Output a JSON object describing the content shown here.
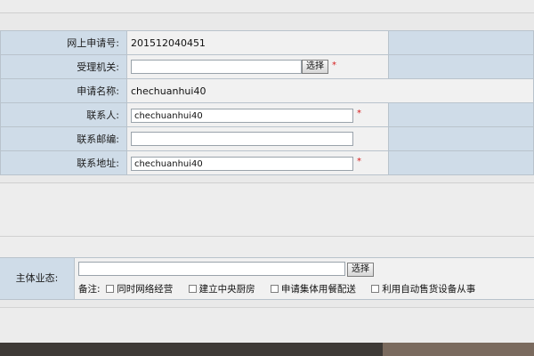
{
  "form": {
    "online_app_no_label": "网上申请号:",
    "online_app_no_value": "201512040451",
    "accept_org_label": "受理机关:",
    "accept_org_value": "",
    "select_label": "选择",
    "applicant_name_label": "申请名称:",
    "applicant_name_value": "chechuanhui40",
    "contact_label": "联系人:",
    "contact_value": "chechuanhui40",
    "postcode_label": "联系邮编:",
    "postcode_value": "",
    "address_label": "联系地址:",
    "address_value": "chechuanhui40",
    "required_mark": "*"
  },
  "business": {
    "main_label": "主体业态:",
    "select_label": "选择",
    "note_label": "备注:",
    "options": [
      "同时网络经营",
      "建立中央厨房",
      "申请集体用餐配送",
      "利用自动售货设备从事"
    ]
  },
  "colors": {
    "label_bg": "#cfdce8",
    "value_bg": "#f1f1f1",
    "required": "#d61c1c"
  }
}
